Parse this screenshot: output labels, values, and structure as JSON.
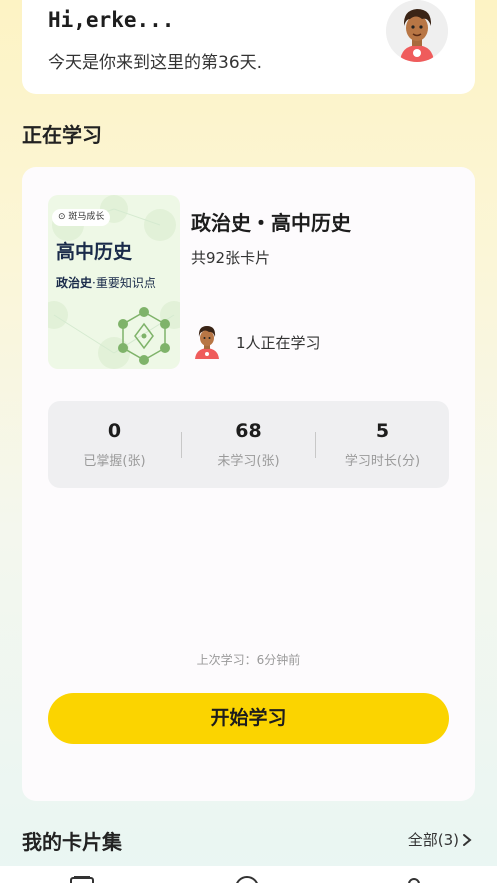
{
  "greeting": {
    "title": "Hi,erke...",
    "subtitle": "今天是你来到这里的第36天."
  },
  "current": {
    "section_title": "正在学习",
    "cover": {
      "badge": "斑马成长",
      "title": "高中历史",
      "subtitle_bold": "政治史",
      "subtitle_rest": "·重要知识点"
    },
    "book_title": "政治史・高中历史",
    "card_count": "共92张卡片",
    "learners": "1人正在学习",
    "stats": [
      {
        "value": "0",
        "label": "已掌握(张)"
      },
      {
        "value": "68",
        "label": "未学习(张)"
      },
      {
        "value": "5",
        "label": "学习时长(分)"
      }
    ],
    "last_study": "上次学习：6分钟前",
    "start_button": "开始学习"
  },
  "collections": {
    "section_title": "我的卡片集",
    "all_label": "全部(3)"
  },
  "colors": {
    "accent": "#fbd400",
    "cover_bg": "#eef8e6",
    "hex_green": "#7fb36a"
  }
}
